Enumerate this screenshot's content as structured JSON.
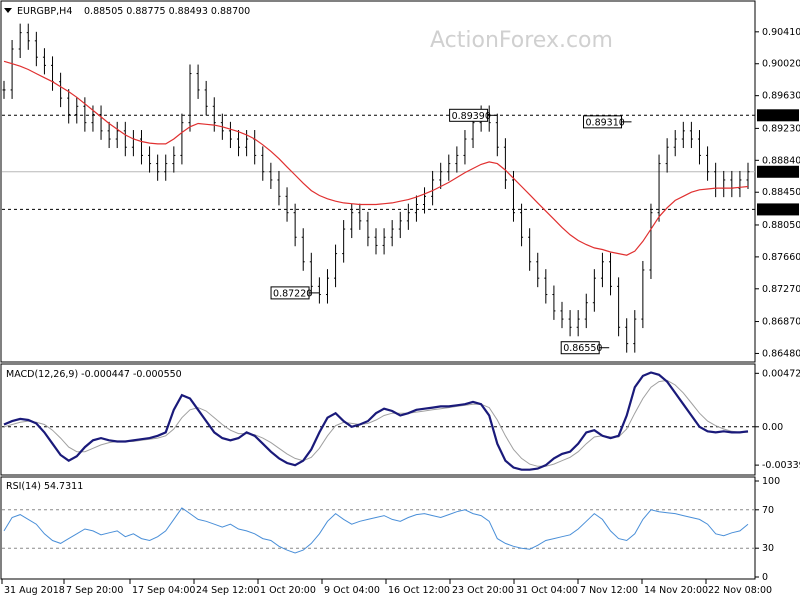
{
  "header": {
    "symbol": "EURGBP,H4",
    "ohlc": "0.88505 0.88775 0.88493 0.88700"
  },
  "watermark": "ActionForex.com",
  "colors": {
    "price": "#000000",
    "ma": "#e03030",
    "macd": "#1a1a7a",
    "signal": "#a0a0a0",
    "rsi": "#4a8fd8",
    "hline": "#000000",
    "current_marker_bg": "#000000",
    "current_marker_text": "#ffffff"
  },
  "chart_data": [
    {
      "type": "line",
      "name": "main-price",
      "yticks": [
        "0.90410",
        "0.90020",
        "0.89630",
        "0.89230",
        "0.88840",
        "0.88450",
        "0.88050",
        "0.87660",
        "0.87270",
        "0.86870",
        "0.86480"
      ],
      "ylim": [
        0.864,
        0.9075
      ],
      "hlines": [
        {
          "label": "0.89390",
          "value": 0.8939
        },
        {
          "label": "0.88240",
          "value": 0.8824
        }
      ],
      "current_price": {
        "label": "0.88700",
        "value": 0.887
      },
      "annotations": [
        {
          "label": "0.89390",
          "x": 0.65,
          "value": 0.8939
        },
        {
          "label": "0.89310",
          "x": 0.83,
          "value": 0.8931
        },
        {
          "label": "0.87220",
          "x": 0.41,
          "value": 0.8722
        },
        {
          "label": "0.86550",
          "x": 0.8,
          "value": 0.8655
        }
      ],
      "price": [
        0.897,
        0.902,
        0.904,
        0.903,
        0.901,
        0.9,
        0.898,
        0.896,
        0.894,
        0.895,
        0.893,
        0.894,
        0.892,
        0.891,
        0.892,
        0.89,
        0.891,
        0.889,
        0.888,
        0.887,
        0.888,
        0.889,
        0.893,
        0.899,
        0.897,
        0.895,
        0.893,
        0.892,
        0.891,
        0.89,
        0.891,
        0.889,
        0.887,
        0.886,
        0.884,
        0.882,
        0.879,
        0.876,
        0.873,
        0.872,
        0.874,
        0.877,
        0.88,
        0.882,
        0.881,
        0.879,
        0.878,
        0.879,
        0.88,
        0.881,
        0.882,
        0.883,
        0.884,
        0.886,
        0.887,
        0.888,
        0.889,
        0.891,
        0.893,
        0.894,
        0.893,
        0.89,
        0.886,
        0.882,
        0.879,
        0.876,
        0.874,
        0.872,
        0.87,
        0.869,
        0.868,
        0.869,
        0.871,
        0.874,
        0.876,
        0.873,
        0.868,
        0.866,
        0.869,
        0.875,
        0.882,
        0.888,
        0.89,
        0.891,
        0.892,
        0.891,
        0.889,
        0.887,
        0.885,
        0.886,
        0.885,
        0.886,
        0.887
      ],
      "ma": [
        0.9005,
        0.9002,
        0.8999,
        0.8995,
        0.899,
        0.8985,
        0.898,
        0.8974,
        0.8968,
        0.8961,
        0.8953,
        0.8945,
        0.8937,
        0.8929,
        0.8922,
        0.8915,
        0.891,
        0.8907,
        0.8905,
        0.8904,
        0.8904,
        0.891,
        0.8918,
        0.8925,
        0.8929,
        0.8928,
        0.8927,
        0.8925,
        0.8922,
        0.8919,
        0.8915,
        0.891,
        0.8903,
        0.8895,
        0.8886,
        0.8876,
        0.8866,
        0.8856,
        0.8847,
        0.8841,
        0.8837,
        0.8834,
        0.8832,
        0.8831,
        0.883,
        0.883,
        0.883,
        0.8831,
        0.8832,
        0.8834,
        0.8836,
        0.8839,
        0.8843,
        0.8847,
        0.8852,
        0.8857,
        0.8863,
        0.8869,
        0.8874,
        0.8879,
        0.8882,
        0.888,
        0.8872,
        0.8862,
        0.8852,
        0.8842,
        0.8832,
        0.8822,
        0.8812,
        0.8802,
        0.8793,
        0.8786,
        0.8781,
        0.8777,
        0.8775,
        0.8772,
        0.877,
        0.8768,
        0.8773,
        0.8785,
        0.88,
        0.8815,
        0.8826,
        0.8835,
        0.884,
        0.8845,
        0.8848,
        0.8849,
        0.885,
        0.885,
        0.885,
        0.8851,
        0.8852
      ]
    },
    {
      "type": "line",
      "name": "macd",
      "title": "MACD(12,26,9) -0.000447 -0.000550",
      "yticks": [
        "0.004729",
        "0.00",
        "-0.003391"
      ],
      "ylim": [
        -0.004,
        0.0052
      ],
      "macd": [
        0.0002,
        0.0005,
        0.0007,
        0.0006,
        0.0003,
        -0.0005,
        -0.0015,
        -0.0025,
        -0.003,
        -0.0026,
        -0.0018,
        -0.0012,
        -0.001,
        -0.0012,
        -0.0013,
        -0.0013,
        -0.0012,
        -0.0011,
        -0.001,
        -0.0008,
        -0.0005,
        0.0015,
        0.0028,
        0.0025,
        0.0015,
        0.0005,
        -0.0005,
        -0.001,
        -0.0012,
        -0.001,
        -0.0005,
        -0.0008,
        -0.0015,
        -0.0022,
        -0.0028,
        -0.0032,
        -0.0034,
        -0.003,
        -0.002,
        -0.0005,
        0.0008,
        0.0012,
        0.0005,
        0.0,
        0.0002,
        0.0005,
        0.0012,
        0.0016,
        0.0014,
        0.001,
        0.0012,
        0.0015,
        0.0016,
        0.0017,
        0.0018,
        0.0018,
        0.0019,
        0.002,
        0.0022,
        0.002,
        0.001,
        -0.0015,
        -0.003,
        -0.0036,
        -0.0038,
        -0.0038,
        -0.0037,
        -0.0034,
        -0.0028,
        -0.0024,
        -0.0022,
        -0.0015,
        -0.0005,
        -0.0003,
        -0.0008,
        -0.001,
        -0.0008,
        0.001,
        0.0035,
        0.0045,
        0.0048,
        0.0046,
        0.004,
        0.003,
        0.002,
        0.001,
        0.0,
        -0.0004,
        -0.0005,
        -0.0004,
        -0.0005,
        -0.0005,
        -0.0004
      ],
      "signal": [
        0.0,
        0.0002,
        0.0004,
        0.0005,
        0.0004,
        0.0002,
        -0.0003,
        -0.001,
        -0.0018,
        -0.0022,
        -0.0022,
        -0.0019,
        -0.0016,
        -0.0014,
        -0.0013,
        -0.0013,
        -0.0013,
        -0.0012,
        -0.0011,
        -0.001,
        -0.0008,
        -0.0002,
        0.0008,
        0.0015,
        0.0017,
        0.0014,
        0.0008,
        0.0002,
        -0.0003,
        -0.0006,
        -0.0006,
        -0.0007,
        -0.001,
        -0.0014,
        -0.0019,
        -0.0024,
        -0.0028,
        -0.003,
        -0.0027,
        -0.0019,
        -0.0008,
        0.0001,
        0.0004,
        0.0003,
        0.0002,
        0.0003,
        0.0006,
        0.001,
        0.0012,
        0.0012,
        0.0012,
        0.0013,
        0.0014,
        0.0015,
        0.0016,
        0.0017,
        0.0018,
        0.0019,
        0.002,
        0.002,
        0.0017,
        0.0006,
        -0.0008,
        -0.002,
        -0.0028,
        -0.0033,
        -0.0035,
        -0.0035,
        -0.0033,
        -0.003,
        -0.0027,
        -0.0022,
        -0.0015,
        -0.0009,
        -0.0008,
        -0.0009,
        -0.0009,
        -0.0002,
        0.0012,
        0.0025,
        0.0035,
        0.004,
        0.0041,
        0.0037,
        0.003,
        0.0021,
        0.0012,
        0.0005,
        0.0001,
        -0.0002,
        -0.0004,
        -0.0005,
        -0.0005
      ]
    },
    {
      "type": "line",
      "name": "rsi",
      "title": "RSI(14) 54.7311",
      "yticks": [
        "100",
        "70",
        "30",
        "0"
      ],
      "ylim": [
        0,
        100
      ],
      "levels": [
        70,
        30
      ],
      "rsi": [
        48,
        62,
        65,
        60,
        55,
        45,
        38,
        35,
        40,
        45,
        50,
        48,
        44,
        46,
        48,
        42,
        45,
        40,
        38,
        42,
        48,
        60,
        72,
        66,
        60,
        58,
        55,
        52,
        55,
        50,
        48,
        45,
        40,
        38,
        32,
        28,
        25,
        28,
        35,
        45,
        58,
        66,
        60,
        55,
        58,
        60,
        62,
        64,
        60,
        58,
        62,
        65,
        66,
        64,
        62,
        65,
        68,
        70,
        66,
        64,
        58,
        40,
        35,
        32,
        30,
        29,
        33,
        38,
        40,
        42,
        44,
        50,
        58,
        66,
        60,
        48,
        40,
        38,
        45,
        60,
        70,
        68,
        67,
        66,
        64,
        62,
        60,
        55,
        45,
        43,
        46,
        48,
        55
      ]
    }
  ],
  "x_axis": {
    "labels": [
      "31 Aug 2018",
      "7 Sep 20:00",
      "17 Sep 04:00",
      "24 Sep 12:00",
      "1 Oct 20:00",
      "9 Oct 04:00",
      "16 Oct 12:00",
      "23 Oct 20:00",
      "31 Oct 04:00",
      "7 Nov 12:00",
      "14 Nov 20:00",
      "22 Nov 08:00"
    ]
  }
}
